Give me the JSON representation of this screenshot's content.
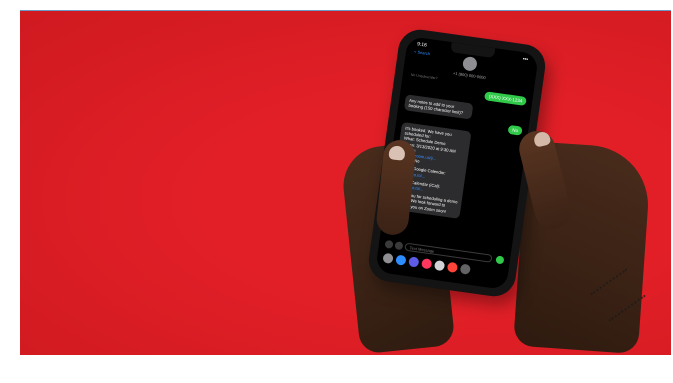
{
  "image": {
    "background_color": "#e21f27",
    "skin_color": "#3d2417"
  },
  "phone": {
    "status_time": "9:16",
    "back_label": "< Search",
    "contact_number": "+1 (800) 000-0000",
    "sub_note": "No Unsubscribe?",
    "messages": {
      "outgoing_1": "(XXX) XXX-1234",
      "incoming_1": "Any notes to add to your booking (150 character limit)?",
      "outgoing_2": "No",
      "incoming_2_line1": "It's booked. We have you scheduled for:",
      "incoming_2_line2": "What: Schedule Demo",
      "incoming_2_line3": "When: 3/13/2020 at 9:30 AM",
      "incoming_2_line4": "Where:",
      "incoming_2_link1": "https://zoom.us/j/...",
      "incoming_2_notes": "Notes:       No",
      "incoming_2_line5": "Add to Google Calendar:",
      "incoming_2_link2": "https://go.to/...",
      "incoming_2_line6": "Add to Calendar (iCal):",
      "incoming_2_link3": "https://go.to/...",
      "incoming_2_line7": "Thank you for scheduling a demo with us! We look forward to meeting you on Zoom soon!"
    },
    "input_placeholder": "Text Message"
  }
}
